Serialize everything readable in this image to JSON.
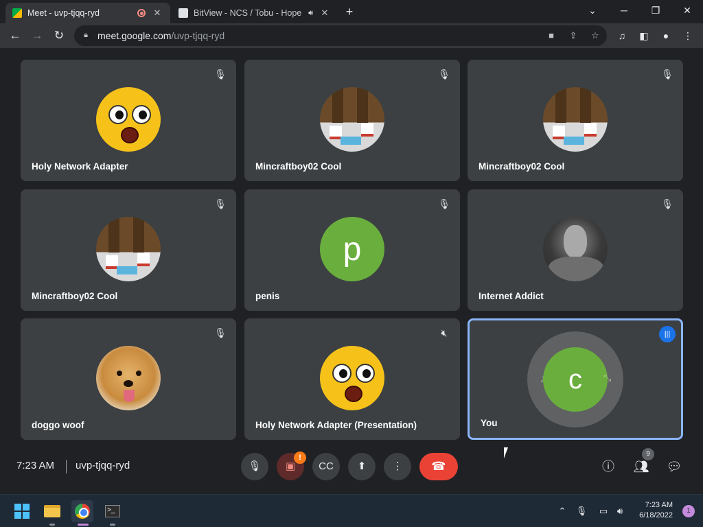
{
  "browser": {
    "tabs": [
      {
        "title": "Meet - uvp-tjqq-ryd",
        "active": true
      },
      {
        "title": "BitView - NCS / Tobu - Hope",
        "active": false
      }
    ],
    "new_tab": "+",
    "address": {
      "host": "meet.google.com",
      "path": "/uvp-tjqq-ryd"
    }
  },
  "participants": [
    {
      "name": "Holy Network Adapter",
      "avatar": "emoji",
      "muted": true
    },
    {
      "name": "Mincraftboy02 Cool",
      "avatar": "minecraft",
      "muted": true
    },
    {
      "name": "Mincraftboy02 Cool",
      "avatar": "minecraft",
      "muted": true
    },
    {
      "name": "Mincraftboy02 Cool",
      "avatar": "minecraft",
      "muted": true
    },
    {
      "name": "penis",
      "avatar": "letter",
      "letter": "p",
      "muted": true
    },
    {
      "name": "Internet Addict",
      "avatar": "photo",
      "muted": true
    },
    {
      "name": "doggo woof",
      "avatar": "dog",
      "muted": true
    },
    {
      "name": "Holy Network Adapter (Presentation)",
      "avatar": "emoji",
      "muted": true
    },
    {
      "name": "You",
      "avatar": "letter",
      "letter": "c",
      "speaking": true
    }
  ],
  "meeting": {
    "time": "7:23 AM",
    "code": "uvp-tjqq-ryd",
    "camera_warning": "!",
    "people_count": "9"
  },
  "taskbar": {
    "time": "7:23 AM",
    "date": "6/18/2022",
    "notifications": "1"
  },
  "colors": {
    "background": "#202124",
    "tile": "#3c4043",
    "end_call": "#ea4335",
    "self_border": "#8ab4f8",
    "avatar_green": "#6aaf3d"
  }
}
